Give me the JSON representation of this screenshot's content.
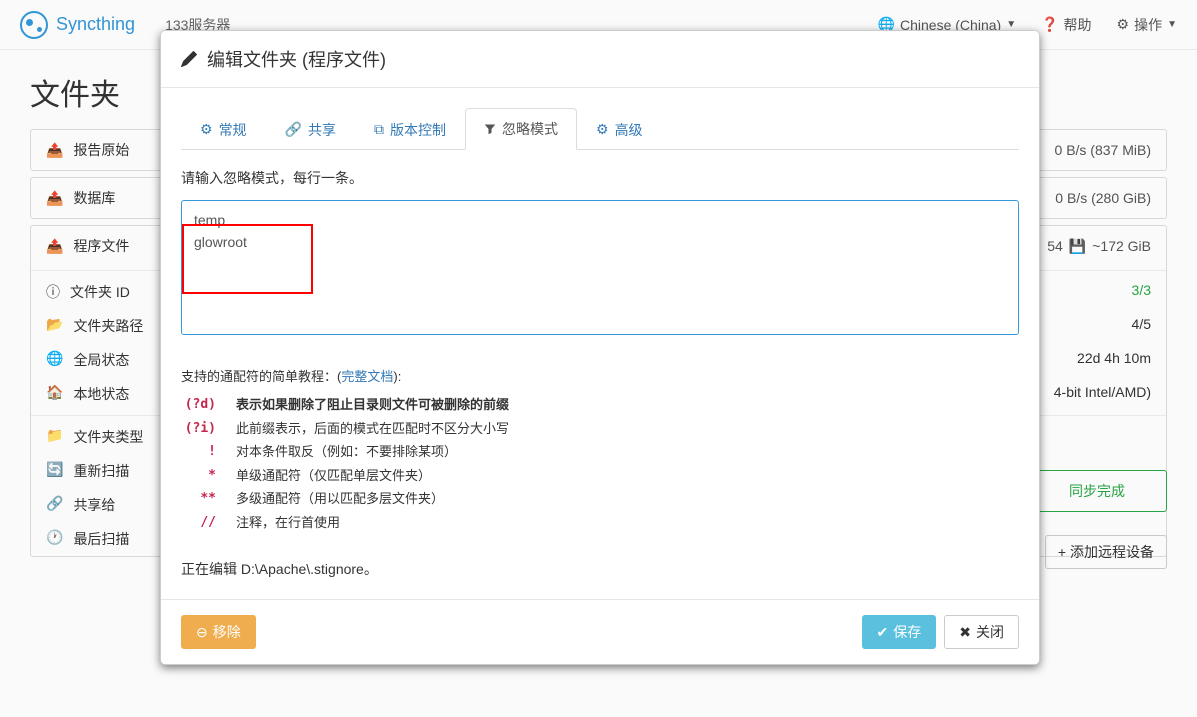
{
  "navbar": {
    "brand": "Syncthing",
    "server": "133服务器",
    "language": "Chinese (China)",
    "help": "帮助",
    "actions": "操作"
  },
  "bg": {
    "heading": "文件夹",
    "folders": [
      {
        "name": "报告原始",
        "right1": "0 B/s (837 MiB)"
      },
      {
        "name": "数据库",
        "right1": "0 B/s (280 GiB)"
      },
      {
        "name": "程序文件",
        "right1": "54",
        "right2": "~172 GiB"
      }
    ],
    "details": [
      {
        "label": "文件夹 ID",
        "value": "3/3",
        "green": true
      },
      {
        "label": "文件夹路径",
        "value": "4/5"
      },
      {
        "label": "全局状态",
        "value": "22d 4h 10m"
      },
      {
        "label": "本地状态",
        "value": "4-bit Intel/AMD)"
      }
    ],
    "detailLinks": [
      "文件夹类型",
      "重新扫描",
      "共享给",
      "最后扫描"
    ],
    "syncStatus": "同步完成",
    "addDevice": "添加远程设备"
  },
  "modal": {
    "title": "编辑文件夹 (程序文件)",
    "tabs": {
      "general": "常规",
      "sharing": "共享",
      "versioning": "版本控制",
      "ignore": "忽略模式",
      "advanced": "高级"
    },
    "ignoreHelp": "请输入忽略模式，每行一条。",
    "ignoreValue": "temp\nglowroot",
    "patternHelpPrefix": "支持的通配符的简单教程：(",
    "patternHelpLink": "完整文档",
    "patternHelpSuffix": "):",
    "patterns": [
      {
        "code": "(?d)",
        "desc": "表示如果删除了阻止目录则文件可被删除的前缀",
        "bold": true
      },
      {
        "code": "(?i)",
        "desc": "此前缀表示，后面的模式在匹配时不区分大小写"
      },
      {
        "code": "!",
        "desc": "对本条件取反（例如：不要排除某项）"
      },
      {
        "code": "*",
        "desc": "单级通配符（仅匹配单层文件夹）"
      },
      {
        "code": "**",
        "desc": "多级通配符（用以匹配多层文件夹）"
      },
      {
        "code": "//",
        "desc": "注释，在行首使用"
      }
    ],
    "editingFile": "正在编辑 D:\\Apache\\.stignore。",
    "footer": {
      "remove": "移除",
      "save": "保存",
      "close": "关闭"
    }
  }
}
